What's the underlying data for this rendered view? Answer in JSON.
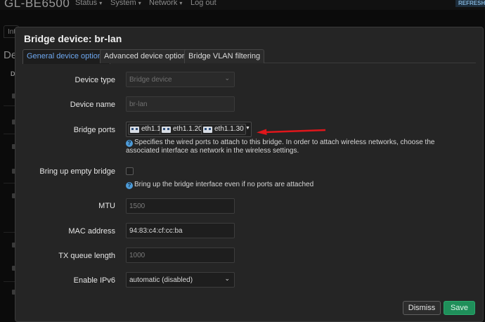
{
  "header": {
    "brand": "GL-BE6500",
    "nav": [
      {
        "label": "Status",
        "has_caret": true
      },
      {
        "label": "System",
        "has_caret": true
      },
      {
        "label": "Network",
        "has_caret": true
      },
      {
        "label": "Log out",
        "has_caret": false
      }
    ],
    "refresh_badge": "REFRESHI"
  },
  "background": {
    "tab_label": "Int",
    "heading": "De",
    "column_header": "D"
  },
  "modal": {
    "title": "Bridge device: br-lan",
    "tabs": [
      {
        "label": "General device options",
        "active": true
      },
      {
        "label": "Advanced device options",
        "active": false
      },
      {
        "label": "Bridge VLAN filtering",
        "active": false
      }
    ],
    "fields": {
      "device_type": {
        "label": "Device type",
        "value": "Bridge device"
      },
      "device_name": {
        "label": "Device name",
        "value": "br-lan"
      },
      "bridge_ports": {
        "label": "Bridge ports",
        "ports": [
          "eth1.1",
          "eth1.1.20",
          "eth1.1.30"
        ],
        "hint": "Specifies the wired ports to attach to this bridge. In order to attach wireless networks, choose the associated interface as network in the wireless settings."
      },
      "bring_up_empty": {
        "label": "Bring up empty bridge",
        "checked": false,
        "hint": "Bring up the bridge interface even if no ports are attached"
      },
      "mtu": {
        "label": "MTU",
        "placeholder": "1500"
      },
      "mac_address": {
        "label": "MAC address",
        "value": "94:83:c4:cf:cc:ba"
      },
      "tx_queue": {
        "label": "TX queue length",
        "placeholder": "1000"
      },
      "ipv6": {
        "label": "Enable IPv6",
        "value": "automatic (disabled)"
      }
    },
    "buttons": {
      "dismiss": "Dismiss",
      "save": "Save"
    }
  },
  "colors": {
    "accent_tab": "#6ea8f0",
    "save_button": "#1f8f5a",
    "annotation_arrow": "#e0161b",
    "hint_icon": "#4d9bd8"
  },
  "icons": {
    "caret": "chevron-down-icon",
    "port": "ethernet-port-icon",
    "hint": "help-circle-icon",
    "annotation": "red-arrow-annotation"
  }
}
